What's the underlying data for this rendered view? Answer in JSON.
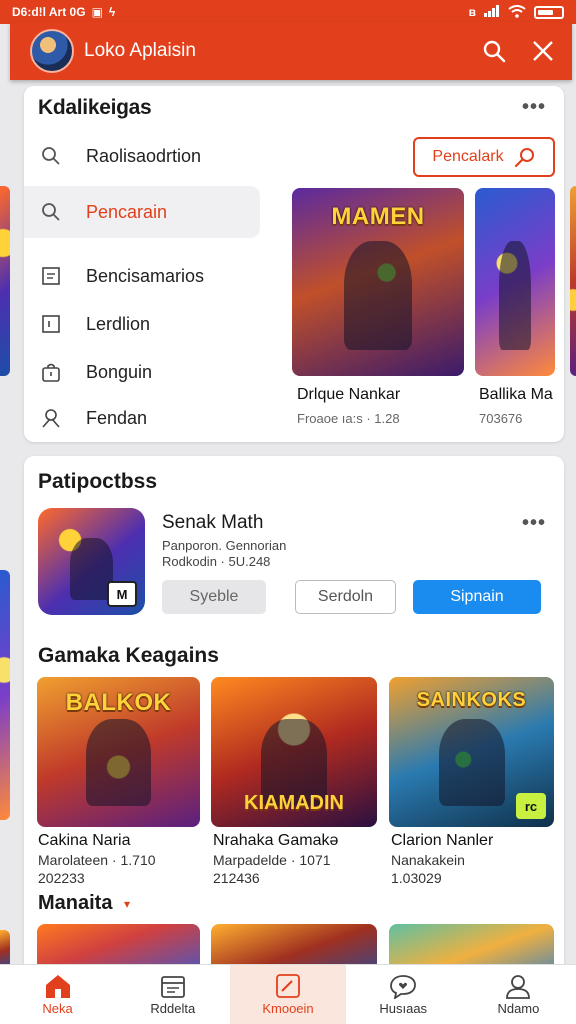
{
  "status_bar": {
    "time_text": "D6:d!l Art 0G",
    "icons": [
      "notification-icon",
      "flash-icon",
      "bluetooth-icon",
      "signal-icon",
      "wifi-icon",
      "battery-icon"
    ]
  },
  "app_bar": {
    "title": "Loko Aplaisin",
    "actions": [
      "search-icon",
      "close-icon"
    ]
  },
  "colors": {
    "accent": "#e2401c",
    "primary_button": "#1a8cf0",
    "active_nav_bg": "#fbe6dd"
  },
  "card1": {
    "title": "Kdalikeigas",
    "filter_button": "Pencalark",
    "menu": [
      {
        "label": "Raolisaodrtion",
        "icon": "search-icon",
        "active": false
      },
      {
        "label": "Pencarain",
        "icon": "search-icon",
        "active": true
      },
      {
        "label": "Bencisamarios",
        "icon": "document-icon",
        "active": false
      },
      {
        "label": "Lerdlion",
        "icon": "square-icon",
        "active": false
      },
      {
        "label": "Bonguin",
        "icon": "bag-icon",
        "active": false
      },
      {
        "label": "Fendan",
        "icon": "person-off-icon",
        "active": false
      }
    ],
    "featured": [
      {
        "name": "Drlque Nankar",
        "sub": "Froaoe ıa:s · 1.28",
        "art_text": "MAMEN"
      },
      {
        "name": "Ballika Ma",
        "sub": "703676"
      }
    ]
  },
  "card2": {
    "title": "Patipoctbss",
    "app": {
      "name": "Senak Math",
      "line1": "Panporon. Gennorian",
      "line2": "Rodkodin · 5U.248",
      "badge": "M",
      "buttons": {
        "grey": "Syeble",
        "outline": "Serdoln",
        "primary": "Sipnain"
      }
    },
    "section_title": "Gamaka Keagains",
    "games": [
      {
        "name": "Cakina Naria",
        "line1": "Marolateen · 1.710",
        "line2": "202233",
        "art_text": "BALKOK"
      },
      {
        "name": "Nrahaka Gamakə",
        "line1": "Marpadelde · 1071",
        "line2": "212436",
        "art_text": "KIAMADIN"
      },
      {
        "name": "Clarion Nanler",
        "line1": "Nanakakein",
        "line2": "1.03029",
        "art_text": "SAINKOKS",
        "badge": "rc"
      }
    ],
    "section2_title": "Manaita"
  },
  "bottom_nav": [
    {
      "label": "Neka",
      "icon": "home-icon",
      "active": true
    },
    {
      "label": "Rddelta",
      "icon": "calendar-icon",
      "active": false
    },
    {
      "label": "Kmooein",
      "icon": "edit-icon",
      "active": false
    },
    {
      "label": "Husıaas",
      "icon": "chat-heart-icon",
      "active": false
    },
    {
      "label": "Ndamo",
      "icon": "user-icon",
      "active": false
    }
  ]
}
